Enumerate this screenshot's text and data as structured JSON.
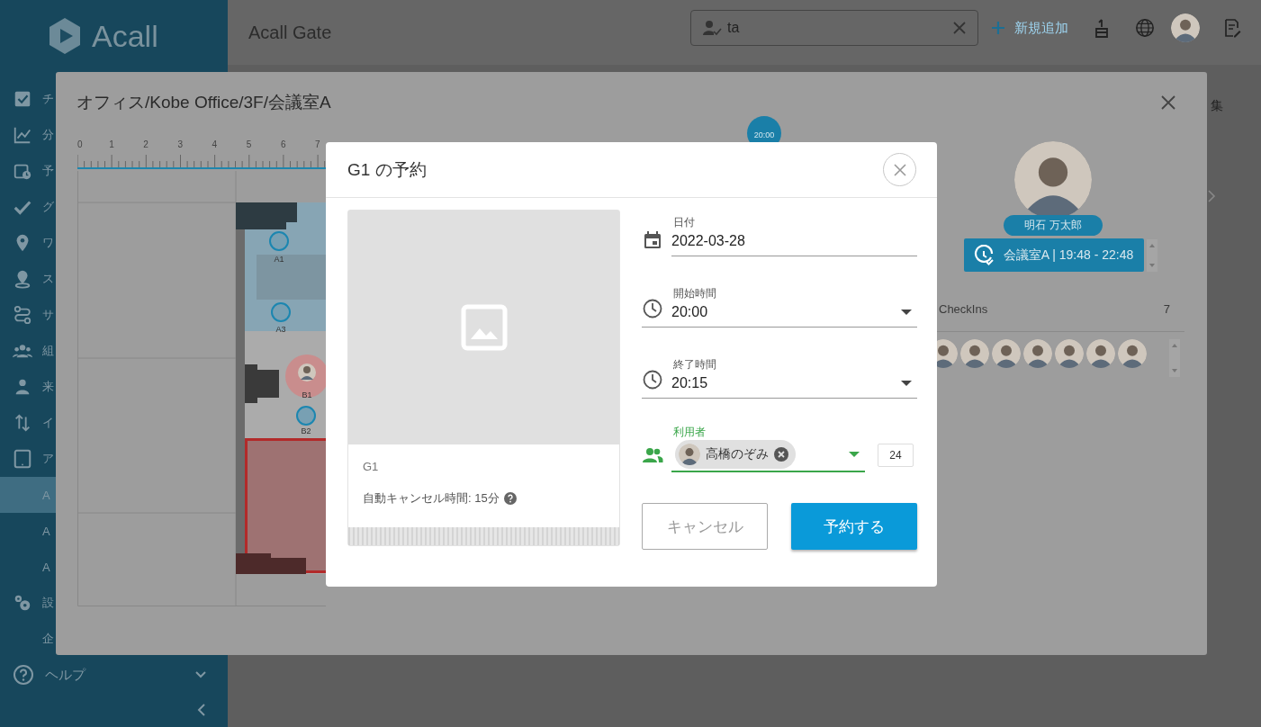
{
  "sidebar": {
    "logo": "Acall",
    "items": [
      {
        "label": "チ",
        "kind": "main",
        "selected": false
      },
      {
        "label": "分",
        "kind": "main",
        "selected": false
      },
      {
        "label": "予",
        "kind": "main",
        "selected": false
      },
      {
        "label": "グ",
        "kind": "main",
        "selected": false
      },
      {
        "label": "ワ",
        "kind": "main",
        "selected": false
      },
      {
        "label": "ス",
        "kind": "main",
        "selected": false
      },
      {
        "label": "サ",
        "kind": "main",
        "selected": false
      },
      {
        "label": "組",
        "kind": "main",
        "selected": false
      },
      {
        "label": "来",
        "kind": "main",
        "selected": false
      },
      {
        "label": "イ",
        "kind": "main",
        "selected": false
      },
      {
        "label": "ア",
        "kind": "main",
        "selected": false
      },
      {
        "label": "A",
        "kind": "sub",
        "selected": true
      },
      {
        "label": "A",
        "kind": "sub",
        "selected": false
      },
      {
        "label": "A",
        "kind": "sub",
        "selected": false
      },
      {
        "label": "設",
        "kind": "main",
        "selected": false
      },
      {
        "label": "企",
        "kind": "sub",
        "selected": false
      }
    ],
    "help": "ヘルプ"
  },
  "header": {
    "title": "Acall Gate",
    "search_value": "ta",
    "add_label": "新規追加"
  },
  "background_edge_text": "集",
  "floor_modal": {
    "title": "オフィス/Kobe Office/3F/会議室A",
    "ruler": [
      "0",
      "1",
      "2",
      "3",
      "4",
      "5",
      "6",
      "7"
    ],
    "time_marker": "20:00",
    "seats": [
      {
        "label": "A1",
        "occupied": false
      },
      {
        "label": "A3",
        "occupied": false
      },
      {
        "label": "B1",
        "occupied": true
      },
      {
        "label": "B2",
        "occupied": false
      }
    ],
    "person": {
      "name": "明石 万太郎",
      "booking": "会議室A | 19:48 - 22:48"
    },
    "checkins": {
      "label": "CheckIns",
      "count": "7",
      "avatars": [
        {
          "kind": "photo"
        },
        {
          "kind": "photo"
        },
        {
          "kind": "photo"
        },
        {
          "kind": "photo"
        },
        {
          "kind": "photo"
        },
        {
          "kind": "photo"
        },
        {
          "kind": "photo"
        }
      ]
    }
  },
  "dialog": {
    "title": "G1 の予約",
    "space_name": "G1",
    "auto_cancel": "自動キャンセル時間: 15分",
    "fields": [
      {
        "kind": "date",
        "label": "日付",
        "value": "2022-03-28"
      },
      {
        "kind": "select",
        "label": "開始時間",
        "value": "20:00"
      },
      {
        "kind": "select",
        "label": "終了時間",
        "value": "20:15"
      },
      {
        "kind": "users",
        "label": "利用者",
        "focused": true,
        "chips": [
          "高橋のぞみ"
        ],
        "count": "24"
      }
    ],
    "buttons": [
      {
        "label": "キャンセル",
        "kind": "secondary"
      },
      {
        "label": "予約する",
        "kind": "primary"
      }
    ]
  }
}
